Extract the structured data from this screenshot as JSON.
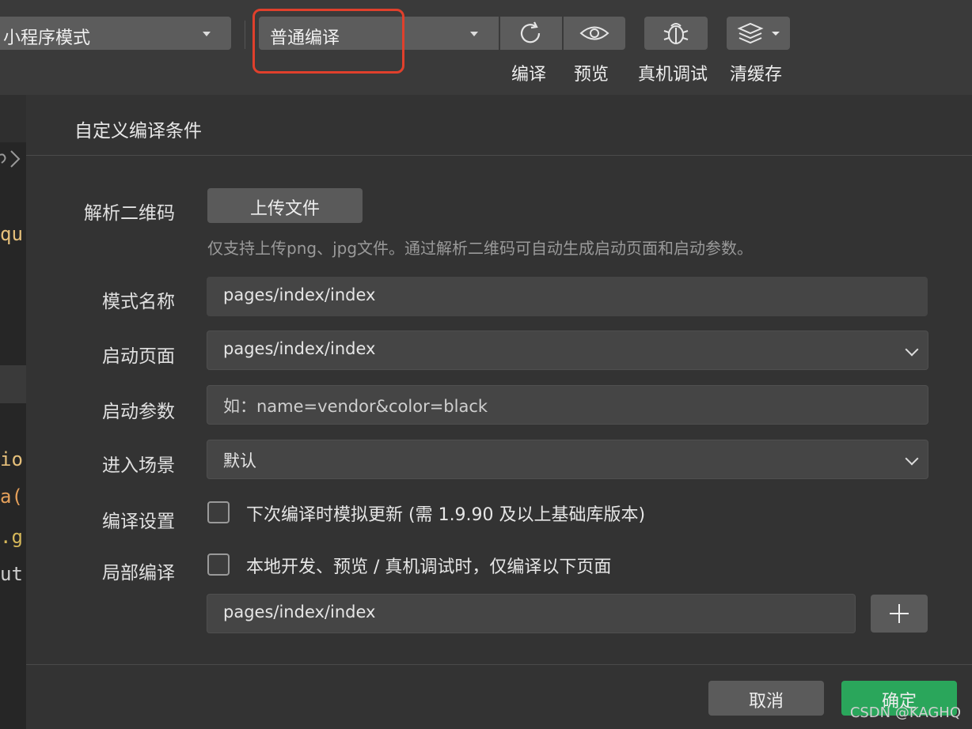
{
  "toolbar": {
    "mode_select": "小程序模式",
    "compile_select": "普通编译",
    "labels": {
      "compile": "编译",
      "preview": "预览",
      "remote_debug": "真机调试",
      "clear_cache": "清缓存"
    }
  },
  "code_fragments": [
    "qu",
    "io",
    "a(",
    ".g",
    "ut"
  ],
  "dialog": {
    "title": "自定义编译条件",
    "qr": {
      "label": "解析二维码",
      "upload_label": "上传文件",
      "hint": "仅支持上传png、jpg文件。通过解析二维码可自动生成启动页面和启动参数。"
    },
    "mode_name": {
      "label": "模式名称",
      "value": "pages/index/index"
    },
    "start_page": {
      "label": "启动页面",
      "value": "pages/index/index"
    },
    "start_params": {
      "label": "启动参数",
      "placeholder": "如：name=vendor&color=black"
    },
    "scene": {
      "label": "进入场景",
      "value": "默认"
    },
    "compile_settings": {
      "label": "编译设置",
      "option": "下次编译时模拟更新 (需 1.9.90 及以上基础库版本)"
    },
    "partial_compile": {
      "label": "局部编译",
      "option": "本地开发、预览 / 真机调试时，仅编译以下页面",
      "page_value": "pages/index/index"
    },
    "buttons": {
      "cancel": "取消",
      "confirm": "确定"
    }
  },
  "watermark": "CSDN @KAGHQ",
  "colors": {
    "highlight": "#e0402c",
    "confirm": "#2aa65b"
  }
}
